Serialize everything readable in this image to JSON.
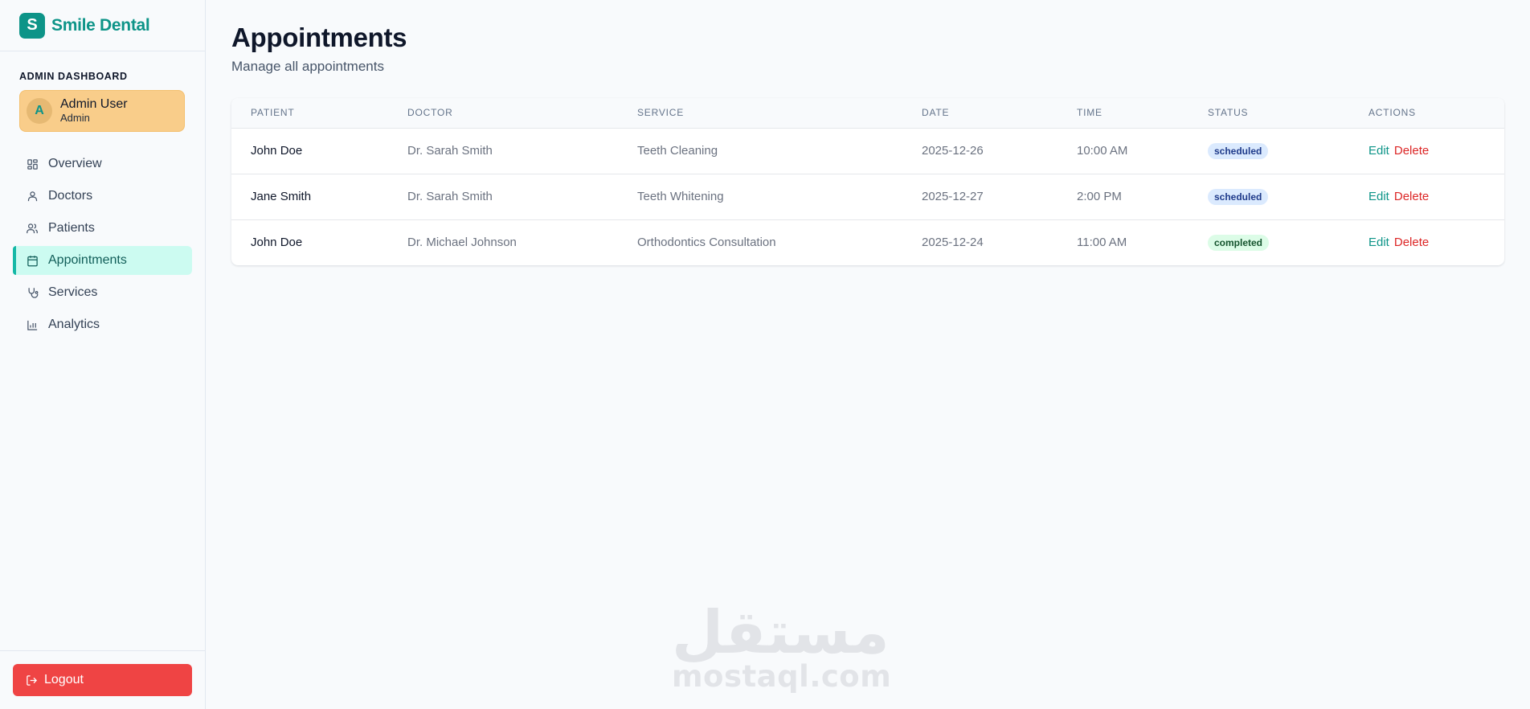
{
  "brand": {
    "logo_letter": "S",
    "name": "Smile Dental",
    "color": "#0d9488"
  },
  "sidebar": {
    "role_label": "ADMIN DASHBOARD",
    "user": {
      "initial": "A",
      "name": "Admin User",
      "role": "Admin"
    },
    "items": [
      {
        "label": "Overview",
        "icon": "grid-icon"
      },
      {
        "label": "Doctors",
        "icon": "user-icon"
      },
      {
        "label": "Patients",
        "icon": "users-icon"
      },
      {
        "label": "Appointments",
        "icon": "calendar-icon",
        "active": true
      },
      {
        "label": "Services",
        "icon": "stethoscope-icon"
      },
      {
        "label": "Analytics",
        "icon": "bar-chart-icon"
      }
    ],
    "logout_label": "Logout"
  },
  "page": {
    "title": "Appointments",
    "subtitle": "Manage all appointments"
  },
  "table": {
    "columns": [
      "PATIENT",
      "DOCTOR",
      "SERVICE",
      "DATE",
      "TIME",
      "STATUS",
      "ACTIONS"
    ],
    "rows": [
      {
        "patient": "John Doe",
        "doctor": "Dr. Sarah Smith",
        "service": "Teeth Cleaning",
        "date": "2025-12-26",
        "time": "10:00 AM",
        "status": "scheduled",
        "edit": "Edit",
        "delete": "Delete"
      },
      {
        "patient": "Jane Smith",
        "doctor": "Dr. Sarah Smith",
        "service": "Teeth Whitening",
        "date": "2025-12-27",
        "time": "2:00 PM",
        "status": "scheduled",
        "edit": "Edit",
        "delete": "Delete"
      },
      {
        "patient": "John Doe",
        "doctor": "Dr. Michael Johnson",
        "service": "Orthodontics Consultation",
        "date": "2025-12-24",
        "time": "11:00 AM",
        "status": "completed",
        "edit": "Edit",
        "delete": "Delete"
      }
    ]
  },
  "watermark": {
    "arabic": "مستقل",
    "latin": "mostaql.com"
  },
  "colors": {
    "accent": "#0d9488",
    "danger": "#ef4444",
    "user_card": "#f9cd8a",
    "active_nav": "#ccfbf1",
    "scheduled_bg": "#dbeafe",
    "completed_bg": "#dcfce7"
  }
}
